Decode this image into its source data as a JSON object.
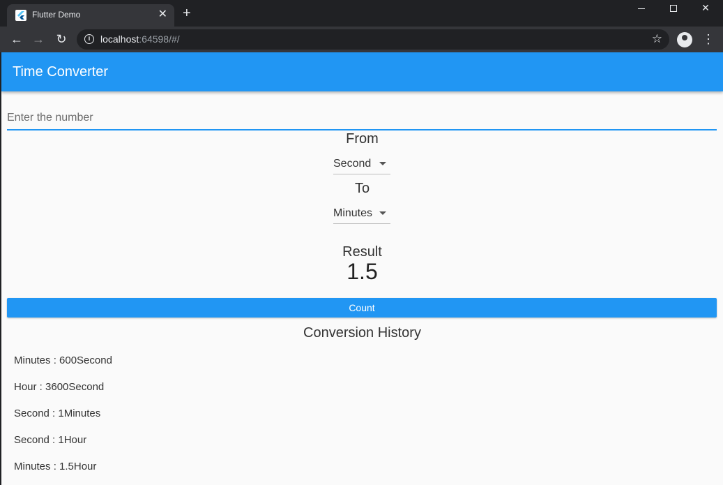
{
  "browser": {
    "tab_title": "Flutter Demo",
    "url_host": "localhost",
    "url_rest": ":64598/#/"
  },
  "app": {
    "title": "Time Converter",
    "input_placeholder": "Enter the number",
    "from_label": "From",
    "from_value": "Second",
    "to_label": "To",
    "to_value": "Minutes",
    "result_label": "Result",
    "result_value": "1.5",
    "count_button": "Count",
    "history_title": "Conversion History",
    "history": [
      "Minutes : 600Second",
      "Hour : 3600Second",
      "Second : 1Minutes",
      "Second : 1Hour",
      "Minutes : 1.5Hour"
    ]
  },
  "colors": {
    "accent": "#2196f3",
    "background": "#fafafa"
  }
}
